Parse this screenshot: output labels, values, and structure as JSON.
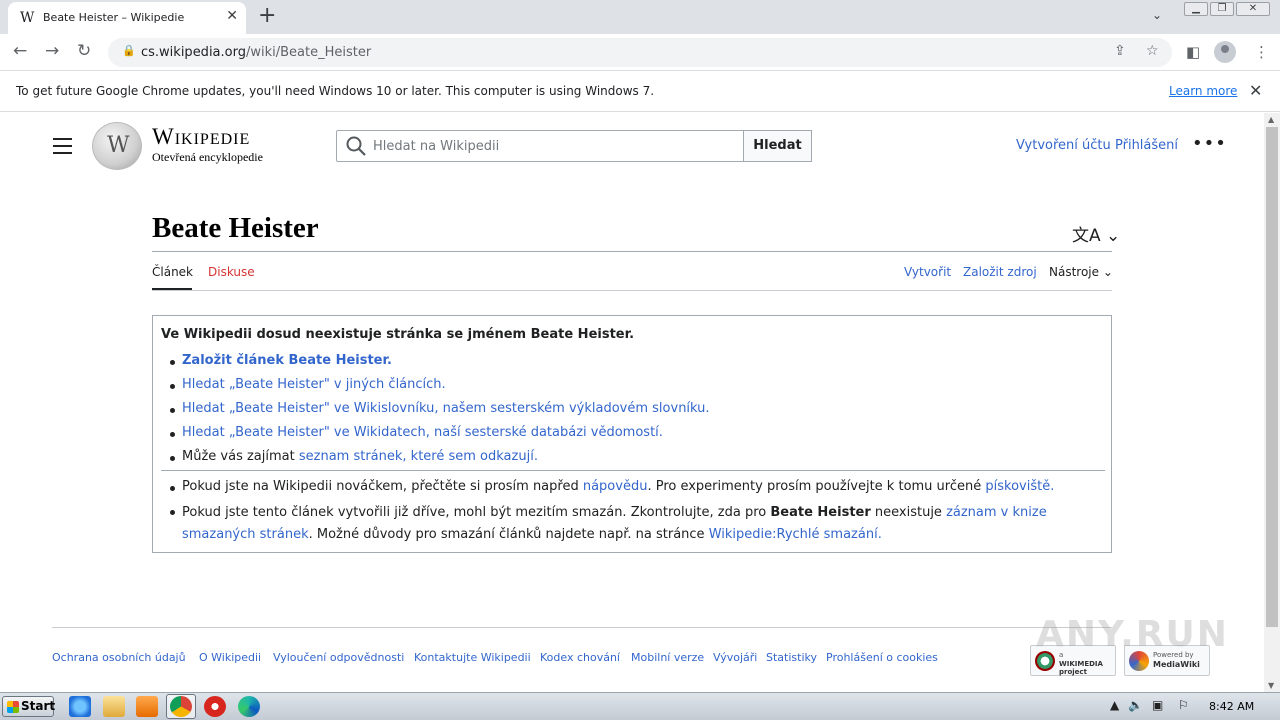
{
  "browser": {
    "tab_favicon": "W",
    "tab_title": "Beate Heister – Wikipedie",
    "new_tab_icon": "+",
    "url_host": "cs.wikipedia.org",
    "url_path": "/wiki/Beate_Heister",
    "infobar_text": "To get future Google Chrome updates, you'll need Windows 10 or later. This computer is using Windows 7.",
    "infobar_link": "Learn more"
  },
  "header": {
    "wordmark": "Wikipedie",
    "tagline": "Otevřená encyklopedie",
    "globe_glyph": "W",
    "search_placeholder": "Hledat na Wikipedii",
    "search_button": "Hledat",
    "create_account": "Vytvoření účtu",
    "login": "Přihlášení",
    "more": "•••"
  },
  "page": {
    "title": "Beate Heister",
    "tabs": {
      "article": "Článek",
      "talk": "Diskuse",
      "create": "Vytvořit",
      "create_source": "Založit zdroj",
      "tools": "Nástroje"
    },
    "notice": {
      "heading": "Ve Wikipedii dosud neexistuje stránka se jménem Beate Heister.",
      "item1": "Založit článek Beate Heister.",
      "item2": "Hledat „Beate Heister\" v jiných článcích.",
      "item3": "Hledat „Beate Heister\" ve Wikislovníku, našem sesterském výkladovém slovníku.",
      "item4": "Hledat „Beate Heister\" ve Wikidatech, naší sesterské databázi vědomostí.",
      "item5_prefix": "Může vás zajímat ",
      "item5_link": "seznam stránek, které sem odkazují",
      "item5_suffix": ".",
      "tip1_prefix": "Pokud jste na Wikipedii nováčkem, přečtěte si prosím napřed ",
      "tip1_link1": "nápovědu",
      "tip1_mid": ". Pro experimenty prosím používejte k tomu určené ",
      "tip1_link2": "pískoviště",
      "tip1_suffix": ".",
      "tip2_prefix": "Pokud jste tento článek vytvořili již dříve, mohl být mezitím smazán. Zkontrolujte, zda pro ",
      "tip2_bold": "Beate Heister",
      "tip2_mid": " neexistuje ",
      "tip2_link1": "záznam v knize smazaných stránek",
      "tip2_mid2": ". Možné důvody pro smazání článků najdete např. na stránce ",
      "tip2_link2": "Wikipedie:Rychlé smazání",
      "tip2_suffix": "."
    }
  },
  "footer": {
    "links": [
      "Ochrana osobních údajů",
      "O Wikipedii",
      "Vyloučení odpovědnosti",
      "Kontaktujte Wikipedii",
      "Kodex chování",
      "Mobilní verze",
      "Vývojáři",
      "Statistiky",
      "Prohlášení o cookies"
    ],
    "wikimedia_badge_line1": "a",
    "wikimedia_badge_line2": "WIKIMEDIA project",
    "mediawiki_badge_line1": "Powered by",
    "mediawiki_badge_line2": "MediaWiki"
  },
  "watermark": "ANY.RUN",
  "taskbar": {
    "start": "Start",
    "clock": "8:42 AM"
  }
}
